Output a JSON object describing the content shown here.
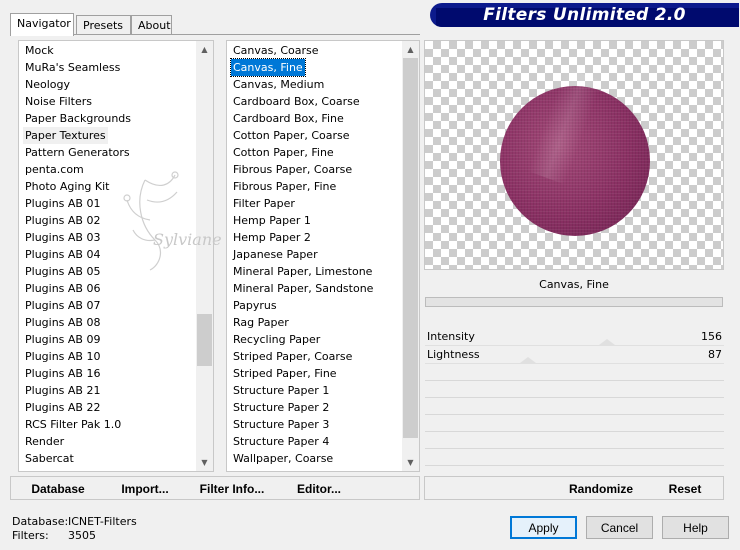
{
  "tabs": [
    {
      "label": "Navigator",
      "active": true
    },
    {
      "label": "Presets",
      "active": false
    },
    {
      "label": "About",
      "active": false
    }
  ],
  "title": "Filters Unlimited 2.0",
  "categories": {
    "items": [
      "Mock",
      "MuRa's Seamless",
      "Neology",
      "Noise Filters",
      "Paper Backgrounds",
      "Paper Textures",
      "Pattern Generators",
      "penta.com",
      "Photo Aging Kit",
      "Plugins AB 01",
      "Plugins AB 02",
      "Plugins AB 03",
      "Plugins AB 04",
      "Plugins AB 05",
      "Plugins AB 06",
      "Plugins AB 07",
      "Plugins AB 08",
      "Plugins AB 09",
      "Plugins AB 10",
      "Plugins AB 16",
      "Plugins AB 21",
      "Plugins AB 22",
      "RCS Filter Pak 1.0",
      "Render",
      "Sabercat"
    ],
    "current": "Paper Textures"
  },
  "filters": {
    "items": [
      "Canvas, Coarse",
      "Canvas, Fine",
      "Canvas, Medium",
      "Cardboard Box, Coarse",
      "Cardboard Box, Fine",
      "Cotton Paper, Coarse",
      "Cotton Paper, Fine",
      "Fibrous Paper, Coarse",
      "Fibrous Paper, Fine",
      "Filter Paper",
      "Hemp Paper 1",
      "Hemp Paper 2",
      "Japanese Paper",
      "Mineral Paper, Limestone",
      "Mineral Paper, Sandstone",
      "Papyrus",
      "Rag Paper",
      "Recycling Paper",
      "Striped Paper, Coarse",
      "Striped Paper, Fine",
      "Structure Paper 1",
      "Structure Paper 2",
      "Structure Paper 3",
      "Structure Paper 4",
      "Wallpaper, Coarse"
    ],
    "selected": "Canvas, Fine"
  },
  "watermark_text": "Sylviane",
  "preview": {
    "filter_name": "Canvas, Fine",
    "circle_color": "#8a3063"
  },
  "params": [
    {
      "label": "Intensity",
      "value": "156"
    },
    {
      "label": "Lightness",
      "value": "87"
    }
  ],
  "left_buttons": {
    "database": "Database",
    "import": "Import...",
    "filter_info": "Filter Info...",
    "editor": "Editor..."
  },
  "right_buttons": {
    "randomize": "Randomize",
    "reset": "Reset"
  },
  "status": {
    "database_label": "Database:",
    "database_value": "ICNET-Filters",
    "filters_label": "Filters:",
    "filters_value": "3505"
  },
  "dialog_buttons": {
    "apply": "Apply",
    "cancel": "Cancel",
    "help": "Help"
  },
  "colors": {
    "selection": "#0078d7",
    "banner": "#000a6e"
  }
}
